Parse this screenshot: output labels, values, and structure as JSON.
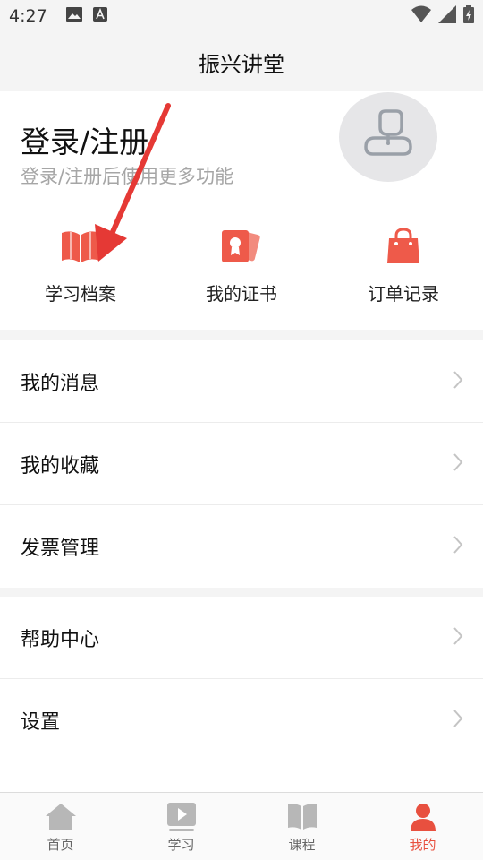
{
  "status_bar": {
    "time": "4:27"
  },
  "header": {
    "title": "振兴讲堂"
  },
  "profile": {
    "login_title": "登录/注册",
    "login_subtitle": "登录/注册后使用更多功能"
  },
  "quick_actions": [
    {
      "label": "学习档案",
      "icon": "book-icon"
    },
    {
      "label": "我的证书",
      "icon": "certificate-icon"
    },
    {
      "label": "订单记录",
      "icon": "shopping-bag-icon"
    }
  ],
  "menu_group_1": [
    {
      "label": "我的消息"
    },
    {
      "label": "我的收藏"
    },
    {
      "label": "发票管理"
    }
  ],
  "menu_group_2": [
    {
      "label": "帮助中心"
    },
    {
      "label": "设置"
    }
  ],
  "bottom_nav": [
    {
      "label": "首页",
      "icon": "home-icon"
    },
    {
      "label": "学习",
      "icon": "play-icon"
    },
    {
      "label": "课程",
      "icon": "book-icon"
    },
    {
      "label": "我的",
      "icon": "person-icon",
      "active": true
    }
  ],
  "colors": {
    "accent": "#e8503f",
    "icon_red": "#ee5a4a",
    "background": "#f4f4f4",
    "annotation_arrow": "#e53935"
  }
}
